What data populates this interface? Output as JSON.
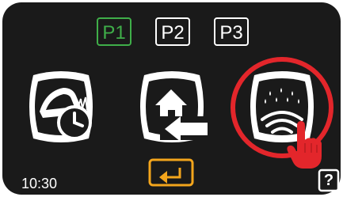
{
  "programs": {
    "items": [
      {
        "label": "P1",
        "active": true
      },
      {
        "label": "P2",
        "active": false
      },
      {
        "label": "P3",
        "active": false
      }
    ]
  },
  "tiles": [
    {
      "icon": "mower-schedule-icon"
    },
    {
      "icon": "return-home-icon"
    },
    {
      "icon": "rain-sensor-icon"
    }
  ],
  "status": {
    "time": "10:30"
  },
  "footer": {
    "back_icon": "back-arrow-icon",
    "help_label": "?"
  },
  "colors": {
    "active_program": "#3fae49",
    "back_accent": "#f3a51c",
    "highlight": "#e3262b",
    "screen_bg": "#1a1a1a"
  }
}
